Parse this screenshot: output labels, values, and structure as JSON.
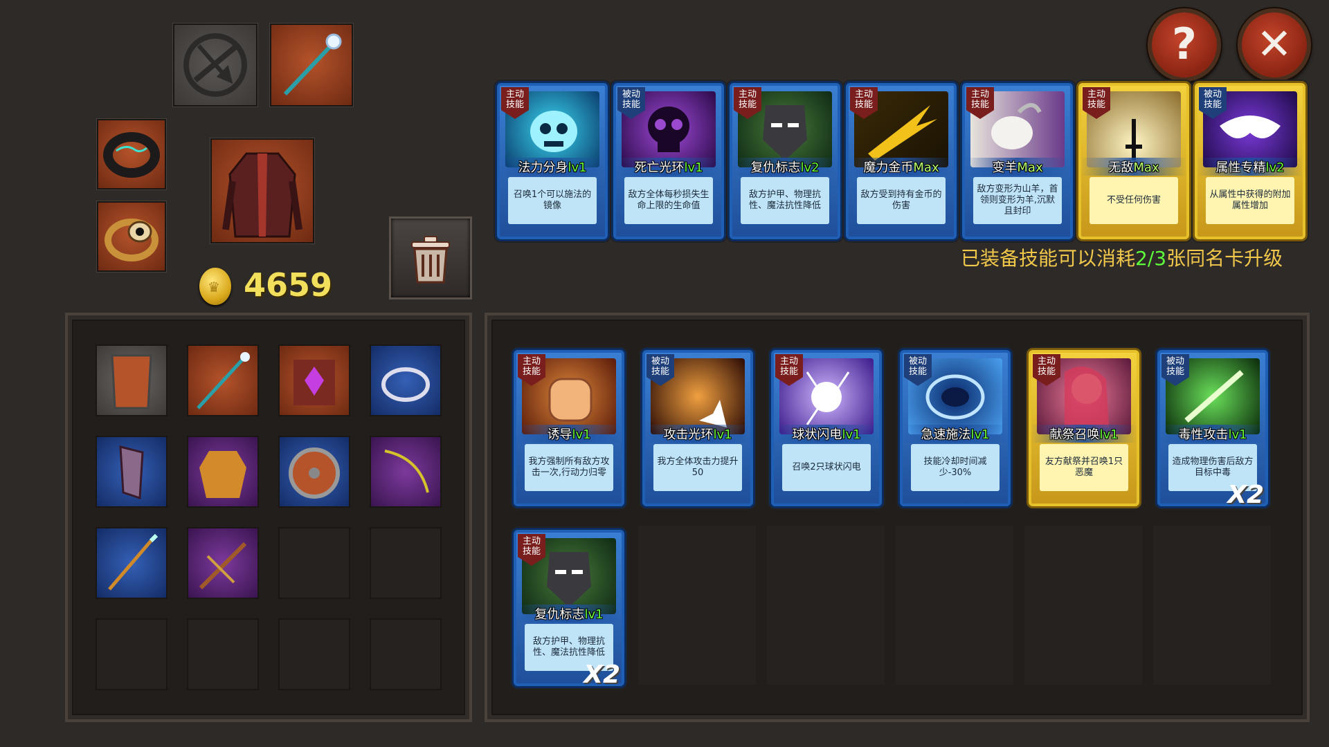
{
  "gold": "4659",
  "buttons": {
    "help": "?",
    "close": "✕"
  },
  "upgrade_hint": {
    "prefix": "已装备技能可以消耗",
    "count": "2/3",
    "suffix": "张同名卡升级"
  },
  "equipped_skills": [
    {
      "type": "主动\n技能",
      "name": "法力分身",
      "level": "lv1",
      "desc": "召唤1个可以施法的镜像",
      "rarity": "blue"
    },
    {
      "type": "被动\n技能",
      "name": "死亡光环",
      "level": "lv1",
      "desc": "敌方全体每秒损失生命上限的生命值",
      "rarity": "blue"
    },
    {
      "type": "主动\n技能",
      "name": "复仇标志",
      "level": "lv2",
      "desc": "敌方护甲、物理抗性、魔法抗性降低",
      "rarity": "blue"
    },
    {
      "type": "主动\n技能",
      "name": "魔力金币",
      "level": "Max",
      "desc": "敌方受到持有金币的伤害",
      "rarity": "blue"
    },
    {
      "type": "主动\n技能",
      "name": "变羊",
      "level": "Max",
      "desc": "敌方变形为山羊，首领则变形为羊,沉默且封印",
      "rarity": "blue"
    },
    {
      "type": "主动\n技能",
      "name": "无敌",
      "level": "Max",
      "desc": "不受任何伤害",
      "rarity": "gold"
    },
    {
      "type": "被动\n技能",
      "name": "属性专精",
      "level": "lv2",
      "desc": "从属性中获得的附加属性增加",
      "rarity": "gold"
    }
  ],
  "inventory_skills": [
    {
      "type": "主动\n技能",
      "name": "诱导",
      "level": "lv1",
      "desc": "我方强制所有敌方攻击一次,行动力归零",
      "rarity": "blue",
      "count": ""
    },
    {
      "type": "被动\n技能",
      "name": "攻击光环",
      "level": "lv1",
      "desc": "我方全体攻击力提升50",
      "rarity": "blue",
      "count": ""
    },
    {
      "type": "主动\n技能",
      "name": "球状闪电",
      "level": "lv1",
      "desc": "召唤2只球状闪电",
      "rarity": "blue",
      "count": ""
    },
    {
      "type": "被动\n技能",
      "name": "急速施法",
      "level": "lv1",
      "desc": "技能冷却时间减少-30%",
      "rarity": "blue",
      "count": ""
    },
    {
      "type": "主动\n技能",
      "name": "献祭召唤",
      "level": "lv1",
      "desc": "友方献祭并召唤1只恶魔",
      "rarity": "gold",
      "count": ""
    },
    {
      "type": "被动\n技能",
      "name": "毒性攻击",
      "level": "lv1",
      "desc": "造成物理伤害后敌方目标中毒",
      "rarity": "blue",
      "count": "X2"
    },
    {
      "type": "主动\n技能",
      "name": "复仇标志",
      "level": "lv1",
      "desc": "敌方护甲、物理抗性、魔法抗性降低",
      "rarity": "blue",
      "count": "X2"
    }
  ]
}
